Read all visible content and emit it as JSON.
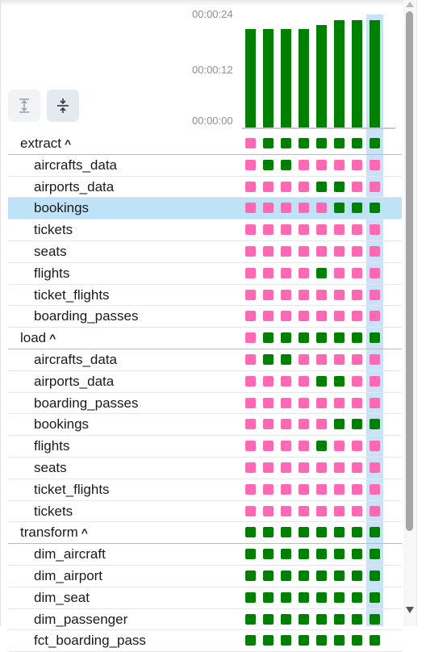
{
  "chart": {
    "y_ticks": [
      "00:00:24",
      "00:00:12",
      "00:00:00"
    ],
    "durations": [
      "00:00:21",
      "00:00:21",
      "00:00:21",
      "00:00:21",
      "00:00:22",
      "00:00:23",
      "00:00:23",
      "00:00:23"
    ]
  },
  "toolbar": {
    "expand_icon": "expand-all-icon",
    "collapse_icon": "collapse-all-icon"
  },
  "colors": {
    "success": "#008000",
    "failed": "#ff69b4",
    "selected_row": "#bee3f8",
    "selected_run": "#c9e2f7"
  },
  "rows": [
    {
      "name": "extract",
      "group": true,
      "states": "PGGGGGGG"
    },
    {
      "name": "aircrafts_data",
      "states": "PGGPPPPP"
    },
    {
      "name": "airports_data",
      "states": "PPPPGGPP"
    },
    {
      "name": "bookings",
      "states": "PPPPPGGG",
      "selected": true
    },
    {
      "name": "tickets",
      "states": "PPPPPPPP"
    },
    {
      "name": "seats",
      "states": "PPPPPPPP"
    },
    {
      "name": "flights",
      "states": "PPPPGPPP"
    },
    {
      "name": "ticket_flights",
      "states": "PPPPPPPP"
    },
    {
      "name": "boarding_passes",
      "states": "PPPPPPPP"
    },
    {
      "name": "load",
      "group": true,
      "states": "PGGGGGGG"
    },
    {
      "name": "aircrafts_data",
      "states": "PGGPPPPP"
    },
    {
      "name": "airports_data",
      "states": "PPPPGGPP"
    },
    {
      "name": "boarding_passes",
      "states": "PPPPPPPP"
    },
    {
      "name": "bookings",
      "states": "PPPPPGGG"
    },
    {
      "name": "flights",
      "states": "PPPPGPPP"
    },
    {
      "name": "seats",
      "states": "PPPPPPPP"
    },
    {
      "name": "ticket_flights",
      "states": "PPPPPPPP"
    },
    {
      "name": "tickets",
      "states": "PPPPPPPP"
    },
    {
      "name": "transform",
      "group": true,
      "states": "GGGGGGGG"
    },
    {
      "name": "dim_aircraft",
      "states": "GGGGGGGG"
    },
    {
      "name": "dim_airport",
      "states": "GGGGGGGG"
    },
    {
      "name": "dim_seat",
      "states": "GGGGGGGG"
    },
    {
      "name": "dim_passenger",
      "states": "GGGGGGGG"
    },
    {
      "name": "fct_boarding_pass",
      "states": "GGGGGGGG"
    }
  ],
  "group_chevron": "^"
}
